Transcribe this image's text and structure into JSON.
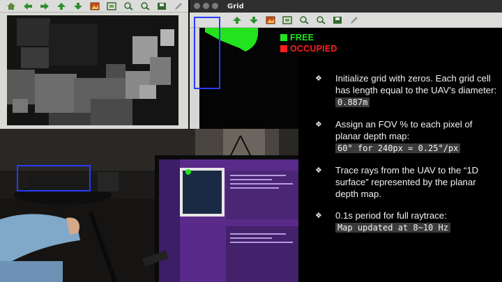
{
  "grid_window": {
    "title": "Grid"
  },
  "legend": {
    "free_label": "FREE",
    "occupied_label": "OCCUPIED",
    "free_color": "#22e31e",
    "occupied_color": "#ff1f1f"
  },
  "toolbar_icons": [
    "home-icon",
    "back-arrow-icon",
    "forward-arrow-icon",
    "up-arrow-icon",
    "down-arrow-icon",
    "image-icon",
    "fit-icon",
    "zoom-in-icon",
    "zoom-out-icon",
    "save-icon",
    "pen-icon"
  ],
  "bullets": [
    {
      "text_before": "Initialize grid with zeros. Each grid cell has length equal to the UAV’s diameter: ",
      "code1": "0.887m"
    },
    {
      "text_before": "Assign an FOV % to each pixel of planar depth map: ",
      "code1": "60° for 240px = 0.25°/px"
    },
    {
      "text_before": "Trace rays from the UAV to the “1D surface” represented by the planar depth map."
    },
    {
      "text_before": "0.1s period for full raytrace: ",
      "code1": "Map updated at 8~10 Hz"
    }
  ],
  "bullet_symbol": "❖",
  "overlay_color": "#2a3bff"
}
